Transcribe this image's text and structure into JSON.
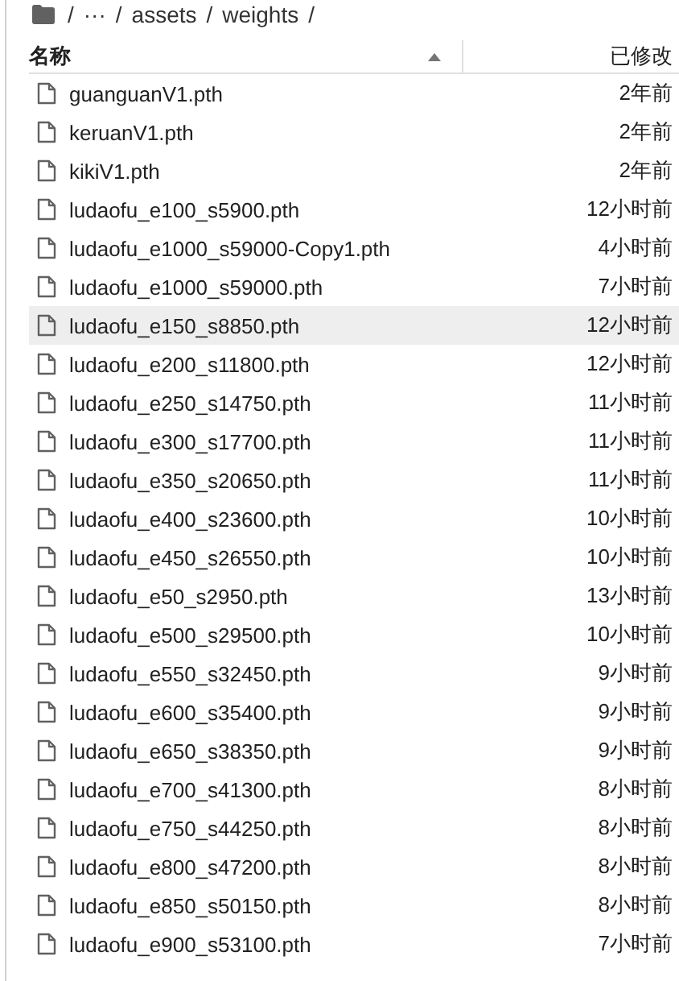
{
  "breadcrumb": {
    "separator": "/",
    "ellipsis": "···",
    "parts": [
      "assets",
      "weights"
    ]
  },
  "table": {
    "columns": [
      {
        "label": "名称",
        "sorted": true
      },
      {
        "label": "已修改"
      }
    ],
    "rows": [
      {
        "name": "guanguanV1.pth",
        "modified": "2年前",
        "selected": false
      },
      {
        "name": "keruanV1.pth",
        "modified": "2年前",
        "selected": false
      },
      {
        "name": "kikiV1.pth",
        "modified": "2年前",
        "selected": false
      },
      {
        "name": "ludaofu_e100_s5900.pth",
        "modified": "12小时前",
        "selected": false
      },
      {
        "name": "ludaofu_e1000_s59000-Copy1.pth",
        "modified": "4小时前",
        "selected": false
      },
      {
        "name": "ludaofu_e1000_s59000.pth",
        "modified": "7小时前",
        "selected": false
      },
      {
        "name": "ludaofu_e150_s8850.pth",
        "modified": "12小时前",
        "selected": true
      },
      {
        "name": "ludaofu_e200_s11800.pth",
        "modified": "12小时前",
        "selected": false
      },
      {
        "name": "ludaofu_e250_s14750.pth",
        "modified": "11小时前",
        "selected": false
      },
      {
        "name": "ludaofu_e300_s17700.pth",
        "modified": "11小时前",
        "selected": false
      },
      {
        "name": "ludaofu_e350_s20650.pth",
        "modified": "11小时前",
        "selected": false
      },
      {
        "name": "ludaofu_e400_s23600.pth",
        "modified": "10小时前",
        "selected": false
      },
      {
        "name": "ludaofu_e450_s26550.pth",
        "modified": "10小时前",
        "selected": false
      },
      {
        "name": "ludaofu_e50_s2950.pth",
        "modified": "13小时前",
        "selected": false
      },
      {
        "name": "ludaofu_e500_s29500.pth",
        "modified": "10小时前",
        "selected": false
      },
      {
        "name": "ludaofu_e550_s32450.pth",
        "modified": "9小时前",
        "selected": false
      },
      {
        "name": "ludaofu_e600_s35400.pth",
        "modified": "9小时前",
        "selected": false
      },
      {
        "name": "ludaofu_e650_s38350.pth",
        "modified": "9小时前",
        "selected": false
      },
      {
        "name": "ludaofu_e700_s41300.pth",
        "modified": "8小时前",
        "selected": false
      },
      {
        "name": "ludaofu_e750_s44250.pth",
        "modified": "8小时前",
        "selected": false
      },
      {
        "name": "ludaofu_e800_s47200.pth",
        "modified": "8小时前",
        "selected": false
      },
      {
        "name": "ludaofu_e850_s50150.pth",
        "modified": "8小时前",
        "selected": false
      },
      {
        "name": "ludaofu_e900_s53100.pth",
        "modified": "7小时前",
        "selected": false
      }
    ]
  }
}
